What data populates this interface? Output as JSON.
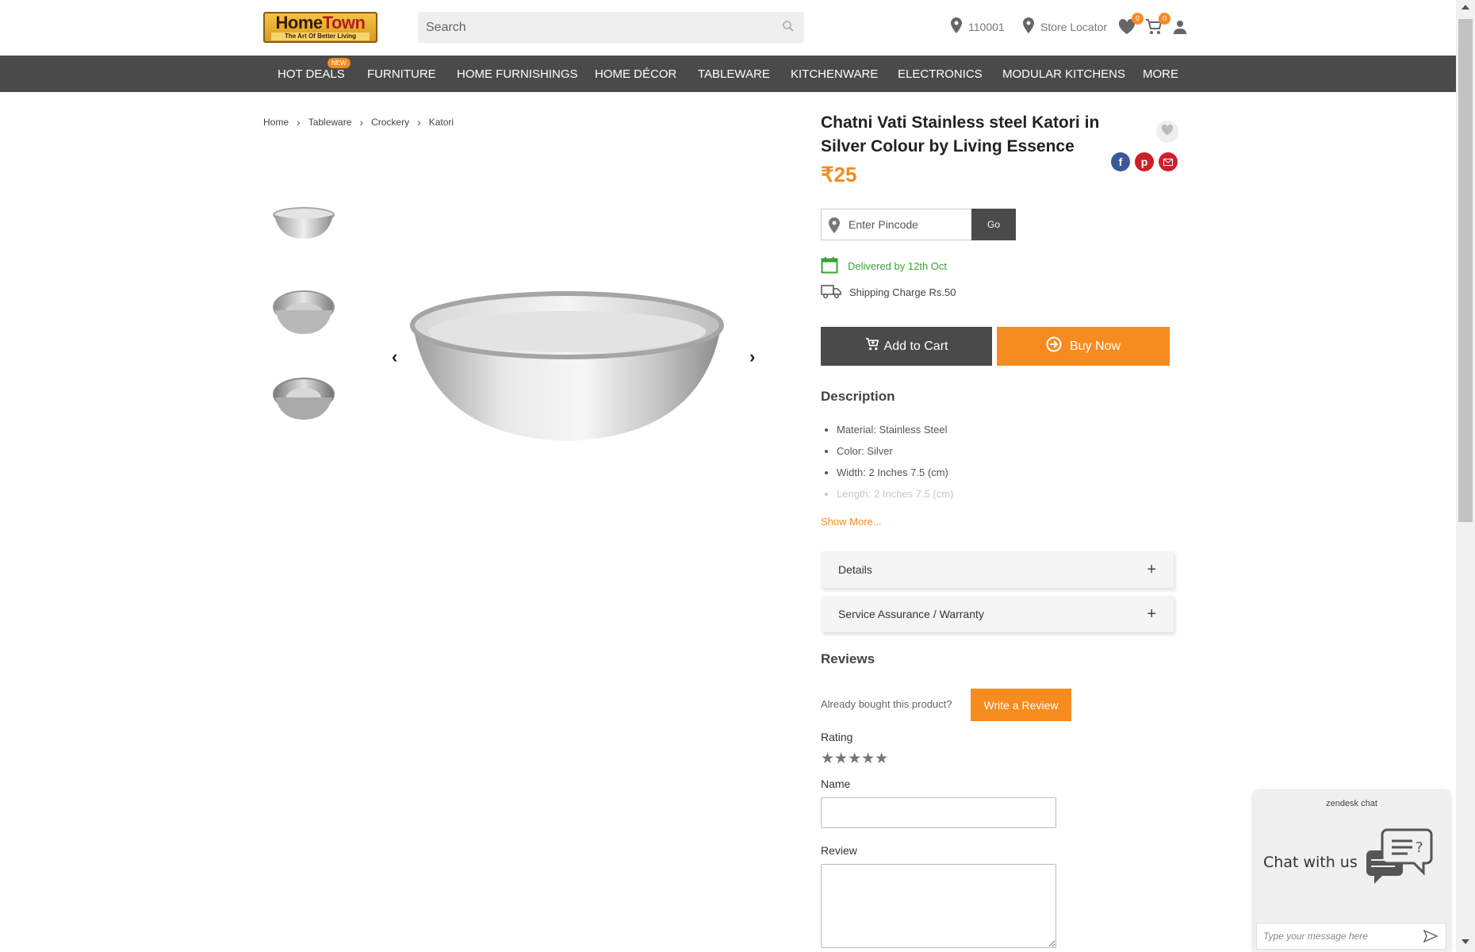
{
  "header": {
    "logo": {
      "brand_part1": "Home",
      "brand_part2": "Town",
      "tagline": "The Art Of Better Living"
    },
    "search_placeholder": "Search",
    "pincode": "110001",
    "store_locator": "Store Locator",
    "wishlist_count": "0",
    "cart_count": "0"
  },
  "nav": {
    "new_badge": "NEW",
    "items": [
      "HOT DEALS",
      "FURNITURE",
      "HOME FURNISHINGS",
      "HOME DÉCOR",
      "TABLEWARE",
      "KITCHENWARE",
      "ELECTRONICS",
      "MODULAR KITCHENS",
      "MORE"
    ]
  },
  "breadcrumb": [
    "Home",
    "Tableware",
    "Crockery",
    "Katori"
  ],
  "product": {
    "title": "Chatni Vati Stainless steel Katori in Silver Colour by Living Essence",
    "price": "₹25",
    "pincode_placeholder": "Enter Pincode",
    "go_label": "Go",
    "delivery": "Delivered by 12th Oct",
    "shipping": "Shipping Charge Rs.50",
    "add_to_cart": "Add to Cart",
    "buy_now": "Buy Now",
    "description_title": "Description",
    "description_items": [
      "Material: Stainless Steel",
      "Color: Silver",
      "Width: 2 Inches 7.5 (cm)",
      "Length: 2 Inches 7.5 (cm)"
    ],
    "show_more": "Show More...",
    "accordions": [
      "Details",
      "Service Assurance / Warranty"
    ]
  },
  "reviews": {
    "title": "Reviews",
    "already_bought": "Already bought this product?",
    "write_review": "Write a Review",
    "rating_label": "Rating",
    "stars": "★★★★★",
    "name_label": "Name",
    "review_label": "Review"
  },
  "chat": {
    "brand": "zendesk chat",
    "label": "Chat with us",
    "placeholder": "Type your message here"
  },
  "colors": {
    "accent": "#f68b1f",
    "nav_bg": "#4a4a4a",
    "delivery_green": "#3aa335"
  }
}
